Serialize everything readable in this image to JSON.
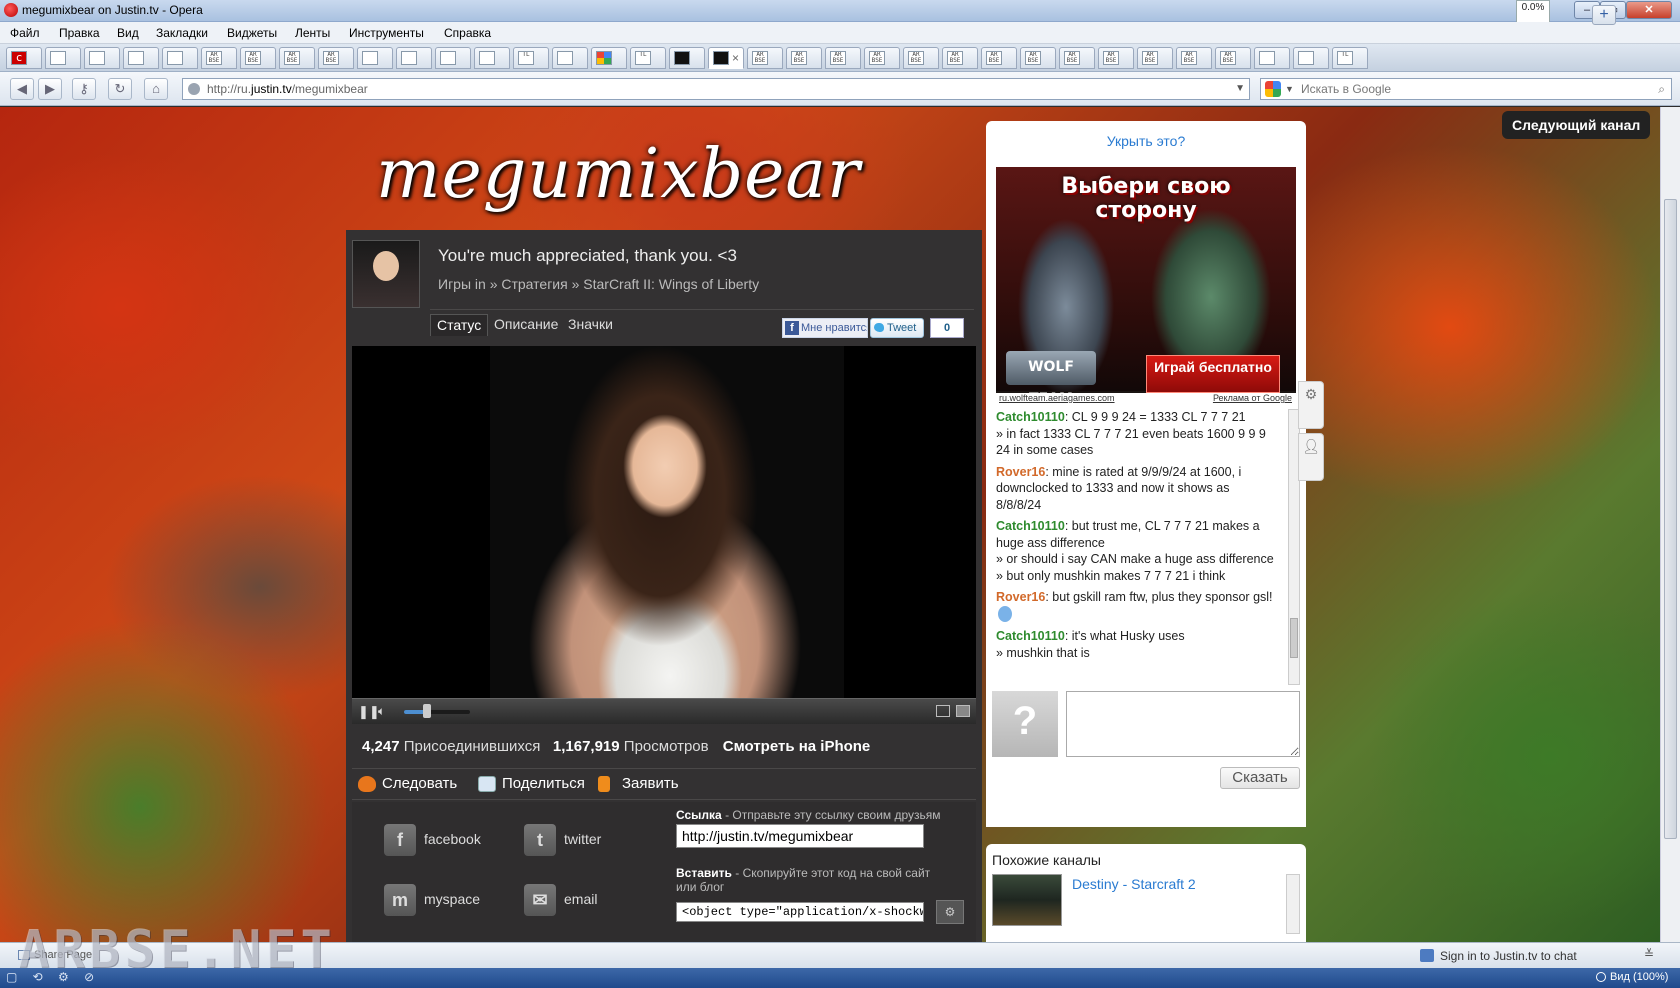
{
  "window": {
    "title": "megumixbear on Justin.tv - Opera",
    "meter": "0.0%",
    "buttons": {
      "min": "–",
      "max": "▭",
      "close": "✕"
    }
  },
  "menu": [
    "Файл",
    "Правка",
    "Вид",
    "Закладки",
    "Виджеты",
    "Ленты",
    "Инструменты",
    "Справка"
  ],
  "tabs": [
    {
      "icon": "c"
    },
    {
      "icon": "doc"
    },
    {
      "icon": "asterisk"
    },
    {
      "icon": "asterisk"
    },
    {
      "icon": "doc"
    },
    {
      "icon": "ar-bse"
    },
    {
      "icon": "ar-bse"
    },
    {
      "icon": "ar-bse"
    },
    {
      "icon": "ar-bse"
    },
    {
      "icon": "page"
    },
    {
      "icon": "doc"
    },
    {
      "icon": "pen"
    },
    {
      "icon": "asterisk"
    },
    {
      "icon": "tl"
    },
    {
      "icon": "download"
    },
    {
      "icon": "google"
    },
    {
      "icon": "tl-net"
    },
    {
      "icon": "screen"
    },
    {
      "icon": "screen-active"
    },
    {
      "icon": "ar-bse"
    },
    {
      "icon": "ar-bse"
    },
    {
      "icon": "ar-bse"
    },
    {
      "icon": "ar-bse"
    },
    {
      "icon": "ar-bse"
    },
    {
      "icon": "ar-bse"
    },
    {
      "icon": "ar-bse"
    },
    {
      "icon": "ar-bse"
    },
    {
      "icon": "ar-bse"
    },
    {
      "icon": "ar-bse"
    },
    {
      "icon": "ar-bse"
    },
    {
      "icon": "ar-bse"
    },
    {
      "icon": "ar-bse"
    },
    {
      "icon": "globe"
    },
    {
      "icon": "globe"
    },
    {
      "icon": "tl"
    }
  ],
  "tab_fav_text": {
    "ar-bse": "AR BSE",
    "tl": "TL",
    "tl-net": "TL",
    "c": "c"
  },
  "address": {
    "prefix": "http://ru.",
    "host": "justin.tv",
    "path": "/megumixbear",
    "search_placeholder": "Искать в Google"
  },
  "page": {
    "channel_name": "megumixbear",
    "next_channel": "Следующий канал",
    "status": "You're much appreciated, thank you. <3",
    "category": "Игры in » Стратегия » StarCraft II: Wings of Liberty",
    "tabs": [
      "Статус",
      "Описание",
      "Значки"
    ],
    "fb_like": "Мне нравится",
    "tweet": "Tweet",
    "tweet_count": "0",
    "stats": {
      "joined_count": "4,247",
      "joined_label": "Присоединившихся",
      "views_count": "1,167,919",
      "views_label": "Просмотров",
      "iphone": "Смотреть на iPhone"
    },
    "player": {
      "volume_level": 0.35
    },
    "actions": {
      "follow": "Следовать",
      "share": "Поделиться",
      "report": "Заявить"
    },
    "social": [
      {
        "name": "facebook",
        "glyph": "f"
      },
      {
        "name": "twitter",
        "glyph": "t"
      },
      {
        "name": "myspace",
        "glyph": "m"
      },
      {
        "name": "email",
        "glyph": "✉"
      }
    ],
    "share_link": {
      "label_bold": "Ссылка",
      "label_rest": " - Отправьте эту ссылку своим друзьям",
      "value": "http://justin.tv/megumixbear"
    },
    "embed": {
      "label_bold": "Вставить",
      "label_rest": " - Скопируйте этот код на свой сайт или блог",
      "value": "<object type=\"application/x-shockwave"
    }
  },
  "chat": {
    "steal_link": "Укрыть это?",
    "ad": {
      "title": "Выбери свою сторону",
      "cta": "Играй бесплатно",
      "logo": "WOLF TEAM",
      "site": "ru.wolfteam.aeriagames.com",
      "ad_by": "Реклама от Google"
    },
    "messages": [
      {
        "nick": "Catch10110",
        "color": "#2e8b2e",
        "lines": [
          ": CL 9 9 9 24 = 1333 CL 7 7 7 21",
          "» in fact 1333 CL 7 7 7 21 even beats 1600 9 9 9 24 in some cases"
        ]
      },
      {
        "nick": "Rover16",
        "color": "#d2692a",
        "lines": [
          ": mine is rated at 9/9/9/24 at 1600, i downclocked to 1333 and now it shows as 8/8/8/24"
        ]
      },
      {
        "nick": "Catch10110",
        "color": "#2e8b2e",
        "lines": [
          ": but trust me, CL 7 7 7 21 makes a huge ass difference",
          "» or should i say CAN make a huge ass difference",
          "» but only mushkin makes 7 7 7 21 i think"
        ]
      },
      {
        "nick": "Rover16",
        "color": "#d2692a",
        "lines": [
          ": but gskill ram ftw, plus they sponsor gsl!"
        ],
        "emoticon": true
      },
      {
        "nick": "Catch10110",
        "color": "#2e8b2e",
        "lines": [
          ": it's what Husky uses",
          "» mushkin that is"
        ]
      }
    ],
    "say_button": "Сказать",
    "avatar_glyph": "?"
  },
  "similar": {
    "title": "Похожие каналы",
    "item": "Destiny - Starcraft 2"
  },
  "status_strip": {
    "share_page": "Share Page",
    "sign_in": "Sign in to Justin.tv to chat",
    "close": "≚"
  },
  "watermark": "ARBSE.NET",
  "taskbar": {
    "zoom": "Вид (100%)"
  }
}
